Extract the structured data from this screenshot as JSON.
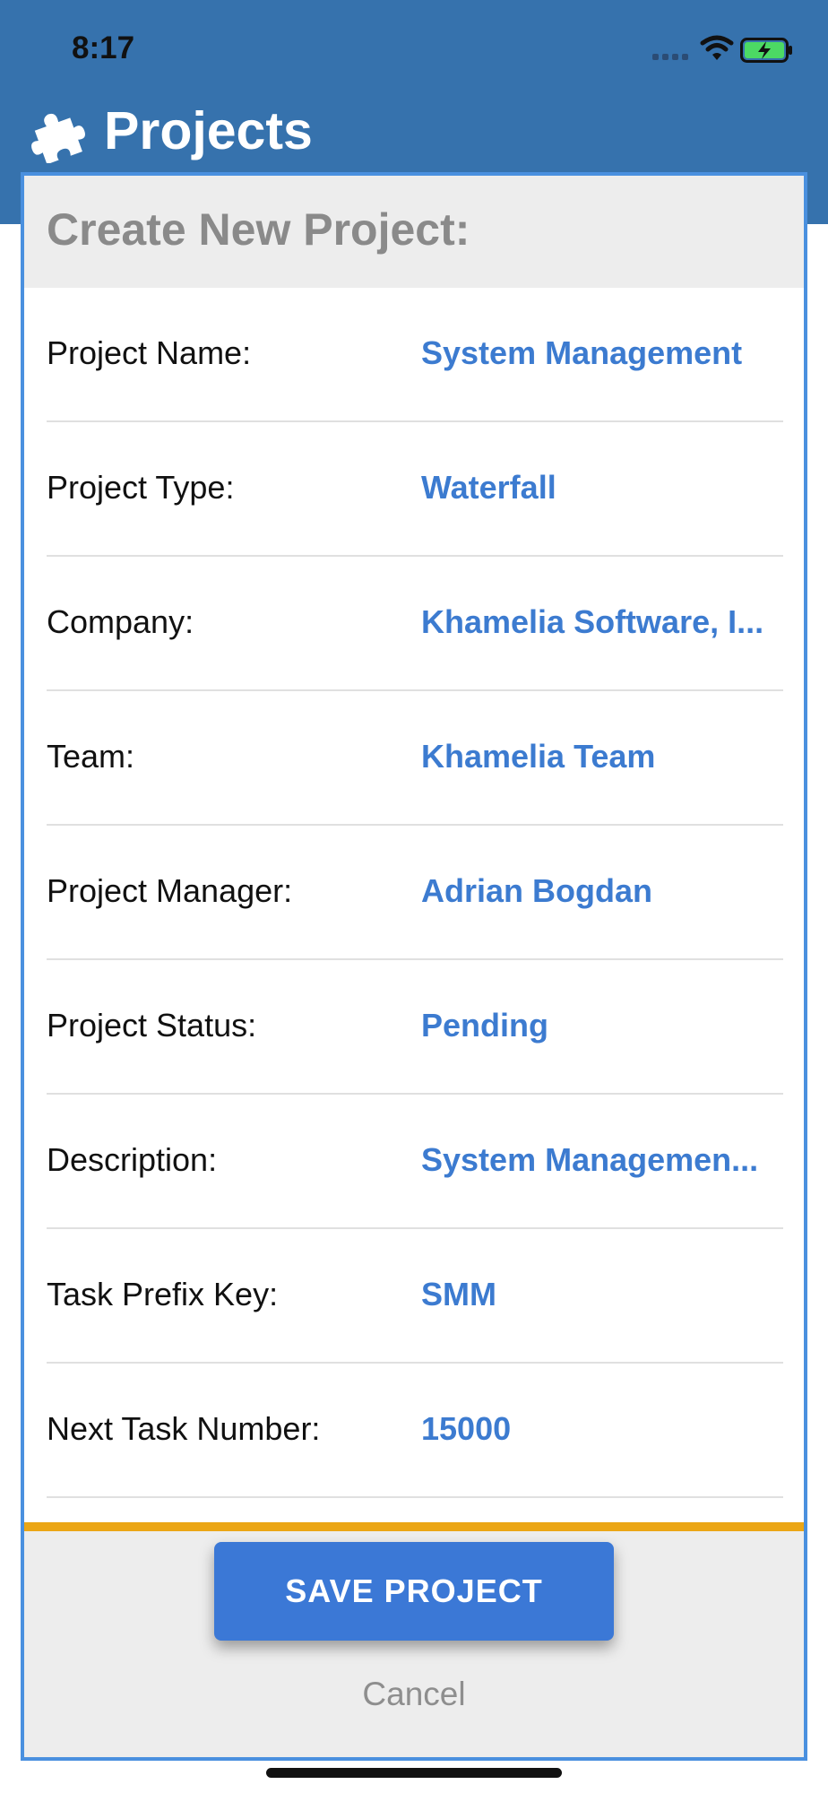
{
  "status_bar": {
    "time": "8:17",
    "icons": [
      "cellular-signal-icon",
      "wifi-icon",
      "battery-charging-icon"
    ]
  },
  "app": {
    "title": "Projects",
    "icon": "puzzle-piece-icon"
  },
  "dialog": {
    "title": "Create New Project:",
    "fields": [
      {
        "label": "Project Name:",
        "value": "System Management"
      },
      {
        "label": "Project Type:",
        "value": "Waterfall"
      },
      {
        "label": "Company:",
        "value": "Khamelia Software, I..."
      },
      {
        "label": "Team:",
        "value": "Khamelia Team"
      },
      {
        "label": "Project Manager:",
        "value": "Adrian Bogdan"
      },
      {
        "label": "Project Status:",
        "value": "Pending"
      },
      {
        "label": "Description:",
        "value": "System Managemen..."
      },
      {
        "label": "Task Prefix Key:",
        "value": "SMM"
      },
      {
        "label": "Next Task Number:",
        "value": "15000"
      }
    ],
    "save_label": "SAVE PROJECT",
    "cancel_label": "Cancel"
  },
  "colors": {
    "header": "#3672ad",
    "dialog_border": "#4a90df",
    "value_text": "#3c7bd0",
    "accent_bar": "#eba615",
    "save_button": "#3b78d6"
  }
}
